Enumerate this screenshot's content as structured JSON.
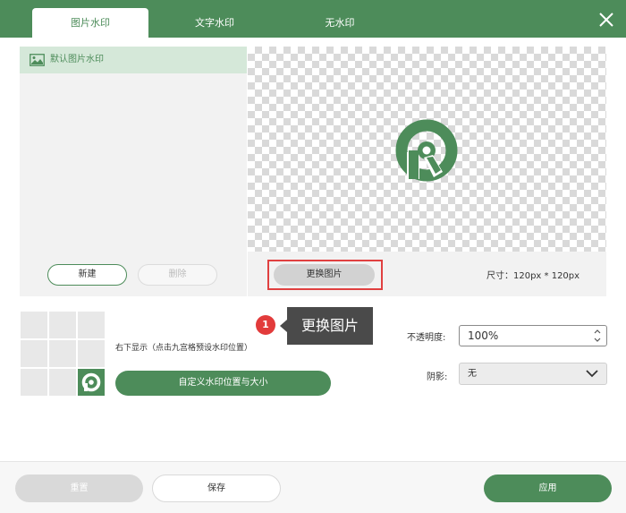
{
  "tabs": [
    {
      "label": "图片水印",
      "active": true
    },
    {
      "label": "文字水印",
      "active": false
    },
    {
      "label": "无水印",
      "active": false
    }
  ],
  "icons": {
    "close": "close-icon",
    "image": "image-icon",
    "logo": "watermark-logo-icon"
  },
  "colors": {
    "accent": "#4d8c5a",
    "highlight": "#e04040"
  },
  "watermark_list": {
    "items": [
      {
        "label": "默认图片水印",
        "selected": true
      }
    ],
    "new_label": "新建",
    "delete_label": "删除"
  },
  "preview": {
    "change_label": "更换图片",
    "size_text": "尺寸：120px * 120px"
  },
  "position": {
    "text": "右下显示（点击九宫格预设水印位置）",
    "selected_cell": 9,
    "custom_label": "自定义水印位置与大小"
  },
  "callout": {
    "number": "1",
    "text": "更换图片"
  },
  "settings": {
    "opacity_label": "不透明度:",
    "opacity_value": "100%",
    "shadow_label": "阴影:",
    "shadow_value": "无"
  },
  "footer": {
    "reset_label": "重置",
    "save_label": "保存",
    "apply_label": "应用"
  }
}
